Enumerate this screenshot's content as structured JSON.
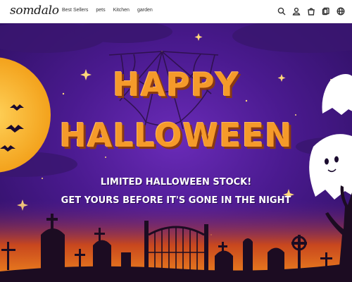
{
  "header": {
    "logo": "somdalo",
    "nav": [
      "Best Sellers",
      "pets",
      "Kitchen",
      "garden"
    ],
    "icons": [
      "search-icon",
      "account-icon",
      "cart-icon",
      "orders-icon",
      "language-icon"
    ]
  },
  "hero": {
    "title_line1": "HAPPY",
    "title_line2": "HALLOWEEN",
    "subtitle_line1": "LIMITED HALLOWEEN STOCK!",
    "subtitle_line2": "GET YOURS BEFORE IT'S GONE IN THE NIGHT"
  },
  "colors": {
    "title": "#f59a2a",
    "sky": "#4a1a8f",
    "moon": "#f8b52a",
    "ground": "#e0661c"
  }
}
